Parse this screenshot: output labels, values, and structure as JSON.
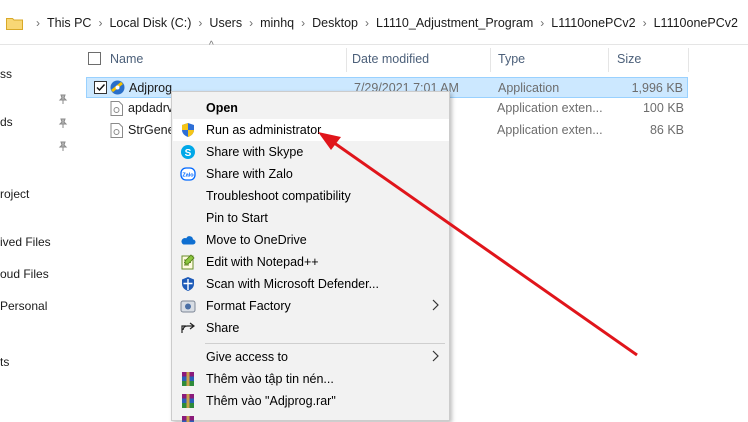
{
  "address": {
    "crumbs": [
      "This PC",
      "Local Disk (C:)",
      "Users",
      "minhq",
      "Desktop",
      "L1110_Adjustment_Program",
      "L1110onePCv2",
      "L1110onePCv2"
    ]
  },
  "sidebar": {
    "items": [
      "ss",
      "ds",
      "roject",
      "ived Files",
      "oud Files",
      "Personal",
      "ts"
    ]
  },
  "columns": {
    "name": "Name",
    "date": "Date modified",
    "type": "Type",
    "size": "Size"
  },
  "files": [
    {
      "name": "Adjprog",
      "date": "7/29/2021 7:01 AM",
      "type": "Application",
      "size": "1,996 KB"
    },
    {
      "name": "apdadrv",
      "date": "",
      "type": "Application exten...",
      "size": "100 KB"
    },
    {
      "name": "StrGene",
      "date": "",
      "type": "Application exten...",
      "size": "86 KB"
    }
  ],
  "menu": {
    "items": [
      {
        "label": "Open",
        "icon": "none"
      },
      {
        "label": "Run as administrator",
        "icon": "uac-shield-icon"
      },
      {
        "label": "Share with Skype",
        "icon": "skype-icon"
      },
      {
        "label": "Share with Zalo",
        "icon": "zalo-icon"
      },
      {
        "label": "Troubleshoot compatibility",
        "icon": "none"
      },
      {
        "label": "Pin to Start",
        "icon": "none"
      },
      {
        "label": "Move to OneDrive",
        "icon": "onedrive-icon"
      },
      {
        "label": "Edit with Notepad++",
        "icon": "notepad-plus-plus-icon"
      },
      {
        "label": "Scan with Microsoft Defender...",
        "icon": "defender-icon"
      },
      {
        "label": "Format Factory",
        "icon": "format-factory-icon"
      },
      {
        "label": "Share",
        "icon": "share-icon"
      },
      {
        "label": "Give access to",
        "icon": "none"
      },
      {
        "label": "Thêm vào tập tin nén...",
        "icon": "winrar-icon"
      },
      {
        "label": "Thêm vào \"Adjprog.rar\"",
        "icon": "winrar-icon"
      }
    ]
  },
  "colors": {
    "selection": "#cce8ff",
    "highlight": "#ffffff",
    "menu_bg": "#f2f2f2",
    "arrow": "#e0151b"
  }
}
